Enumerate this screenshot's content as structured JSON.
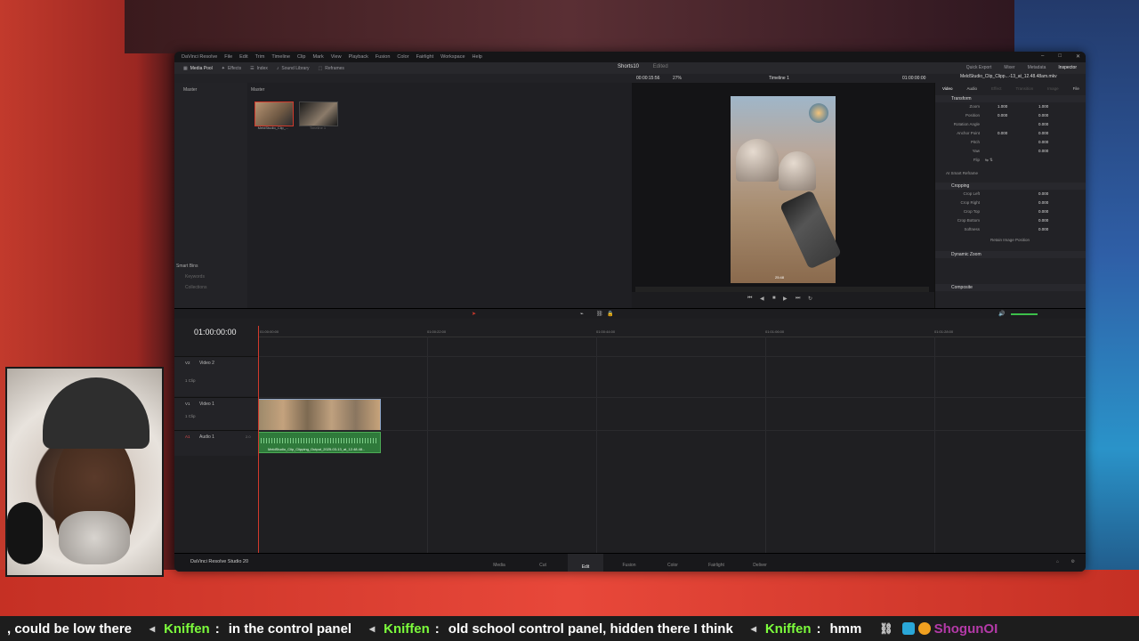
{
  "menu": [
    "DaVinci Resolve",
    "File",
    "Edit",
    "Trim",
    "Timeline",
    "Clip",
    "Mark",
    "View",
    "Playback",
    "Fusion",
    "Color",
    "Fairlight",
    "Workspace",
    "Help"
  ],
  "toolbar": {
    "left": [
      "Media Pool",
      "Effects",
      "Index",
      "Sound Library",
      "Reframes"
    ],
    "project": "Shorts10",
    "edited": "Edited",
    "right": [
      "Quick Export",
      "Mixer",
      "Metadata",
      "Inspector"
    ]
  },
  "subbar": {
    "zoom": "27%",
    "timeline_name": "Timeline 1",
    "tc_left": "00:00:15:56",
    "tc_right": "01:00:00:00"
  },
  "media_pool": {
    "master": "Master",
    "pool_header": "Master",
    "clips": [
      {
        "name": "MeldStudio_Clip_..."
      },
      {
        "name": "Timeline 1"
      }
    ],
    "smart_bins": "Smart Bins",
    "smart_sub": [
      "Keywords",
      "Collections"
    ]
  },
  "viewer": {
    "overlay_text": "25:48"
  },
  "inspector": {
    "clip_title": "MeldStudio_Clip_Clipp...-13_at_12.48.48am.mkv",
    "tabs": [
      "Video",
      "Audio",
      "Effect",
      "Transition",
      "Image",
      "File"
    ],
    "transform": "Transform",
    "rows": [
      {
        "label": "Zoom",
        "x": "1.000",
        "y": "1.000"
      },
      {
        "label": "Position",
        "x": "0.000",
        "y": "0.000"
      },
      {
        "label": "Rotation Angle",
        "x": "",
        "y": "0.000"
      },
      {
        "label": "Anchor Point",
        "x": "0.000",
        "y": "0.000"
      },
      {
        "label": "Pitch",
        "x": "",
        "y": "0.000"
      },
      {
        "label": "Yaw",
        "x": "",
        "y": "0.000"
      },
      {
        "label": "Flip",
        "x": "",
        "y": ""
      }
    ],
    "smart_reframe": "AI Smart Reframe",
    "cropping": "Cropping",
    "crop_rows": [
      {
        "label": "Crop Left",
        "v": "0.000"
      },
      {
        "label": "Crop Right",
        "v": "0.000"
      },
      {
        "label": "Crop Top",
        "v": "0.000"
      },
      {
        "label": "Crop Bottom",
        "v": "0.000"
      },
      {
        "label": "Softness",
        "v": "0.000"
      }
    ],
    "retain": "Retain Image Position",
    "dynamic_zoom": "Dynamic Zoom",
    "composite": "Composite"
  },
  "timeline": {
    "timecode": "01:00:00:00",
    "ruler": [
      "01:00:00:00",
      "01:00:22:00",
      "01:00:44:00",
      "01:01:06:00",
      "01:01:28:00"
    ],
    "tracks": [
      {
        "id": "V2",
        "name": "Video 2",
        "clips": "1 Clip"
      },
      {
        "id": "V1",
        "name": "Video 1",
        "clips": "1 Clip"
      },
      {
        "id": "A1",
        "name": "Audio 1",
        "level": "2.0"
      }
    ],
    "audio_clip_name": "MeldStudio_Clip_Clipping_Output_2025-03-13_at_12.48.48..."
  },
  "pages": {
    "brand": "DaVinci Resolve Studio 20",
    "items": [
      "Media",
      "Cut",
      "Edit",
      "Fusion",
      "Color",
      "Fairlight",
      "Deliver"
    ],
    "active": "Edit"
  },
  "chat": [
    {
      "user": "",
      "text": ", could be low there"
    },
    {
      "user": "Kniffen",
      "colon": ":",
      "text": "in the control panel"
    },
    {
      "user": "Kniffen",
      "colon": ":",
      "text": "old school control panel, hidden there I think"
    },
    {
      "user": "Kniffen",
      "colon": ":",
      "text": "hmm"
    },
    {
      "user": "ShogunOI",
      "colon": "",
      "text": ""
    }
  ],
  "colors": {
    "accent": "#d23a2c",
    "chat_user": "#7cfc3c",
    "audio_clip": "#2f7a3b"
  }
}
